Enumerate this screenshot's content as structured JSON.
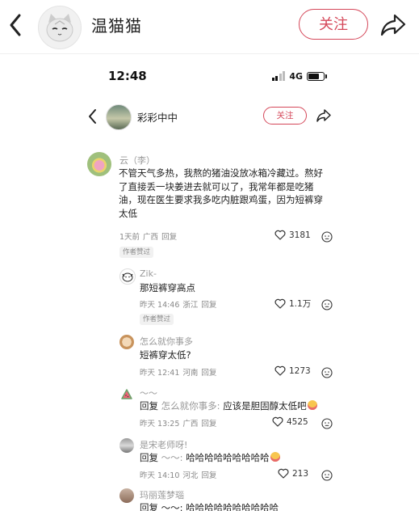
{
  "outer_header": {
    "title": "温猫猫",
    "follow_label": "关注"
  },
  "phone": {
    "status": {
      "time": "12:48",
      "network": "4G"
    },
    "header": {
      "name": "彩彩中中",
      "follow_label": "关注"
    },
    "comments": [
      {
        "name": "云（李）",
        "text": "不管天气多热，我熬的猪油没放冰箱冷藏过。熬好了直接丢一块姜进去就可以了，我常年都是吃猪油，现在医生要求我多吃内脏跟鸡蛋，因为短裤穿太低",
        "time": "1天前",
        "location": "广西",
        "reply": "回复",
        "likes": "3181",
        "badge": "作者赞过"
      },
      {
        "name": "Zik-",
        "text": "那短裤穿高点",
        "time": "昨天 14:46",
        "location": "浙江",
        "reply": "回复",
        "likes": "1.1万",
        "badge": "作者赞过"
      },
      {
        "name": "怎么就你事多",
        "text": "短裤穿太低?",
        "time": "昨天 12:41",
        "location": "河南",
        "reply": "回复",
        "likes": "1273"
      },
      {
        "name": "～～",
        "text_prefix": "回复",
        "text_target": "怎么就你事多:",
        "text_body": "应该是胆固醇太低吧",
        "time": "昨天 13:25",
        "location": "广西",
        "reply": "回复",
        "likes": "4525"
      },
      {
        "name": "是宋老师呀!",
        "text_prefix": "回复",
        "text_target": "～～:",
        "text_body": "哈哈哈哈哈哈哈哈哈",
        "time": "昨天 14:10",
        "location": "河北",
        "reply": "回复",
        "likes": "213"
      },
      {
        "name": "玛丽莲梦瑙",
        "text": "回复 ～～: 哈哈哈哈哈哈哈哈哈哈"
      }
    ]
  },
  "icons": {
    "back": "chevron-left-icon",
    "share": "share-arrow-icon",
    "like": "heart-outline-icon",
    "dislike": "unhappy-face-icon",
    "emoji": "laughing-face-emoji"
  },
  "colors": {
    "accent": "#d5485a",
    "meta": "#888888"
  }
}
